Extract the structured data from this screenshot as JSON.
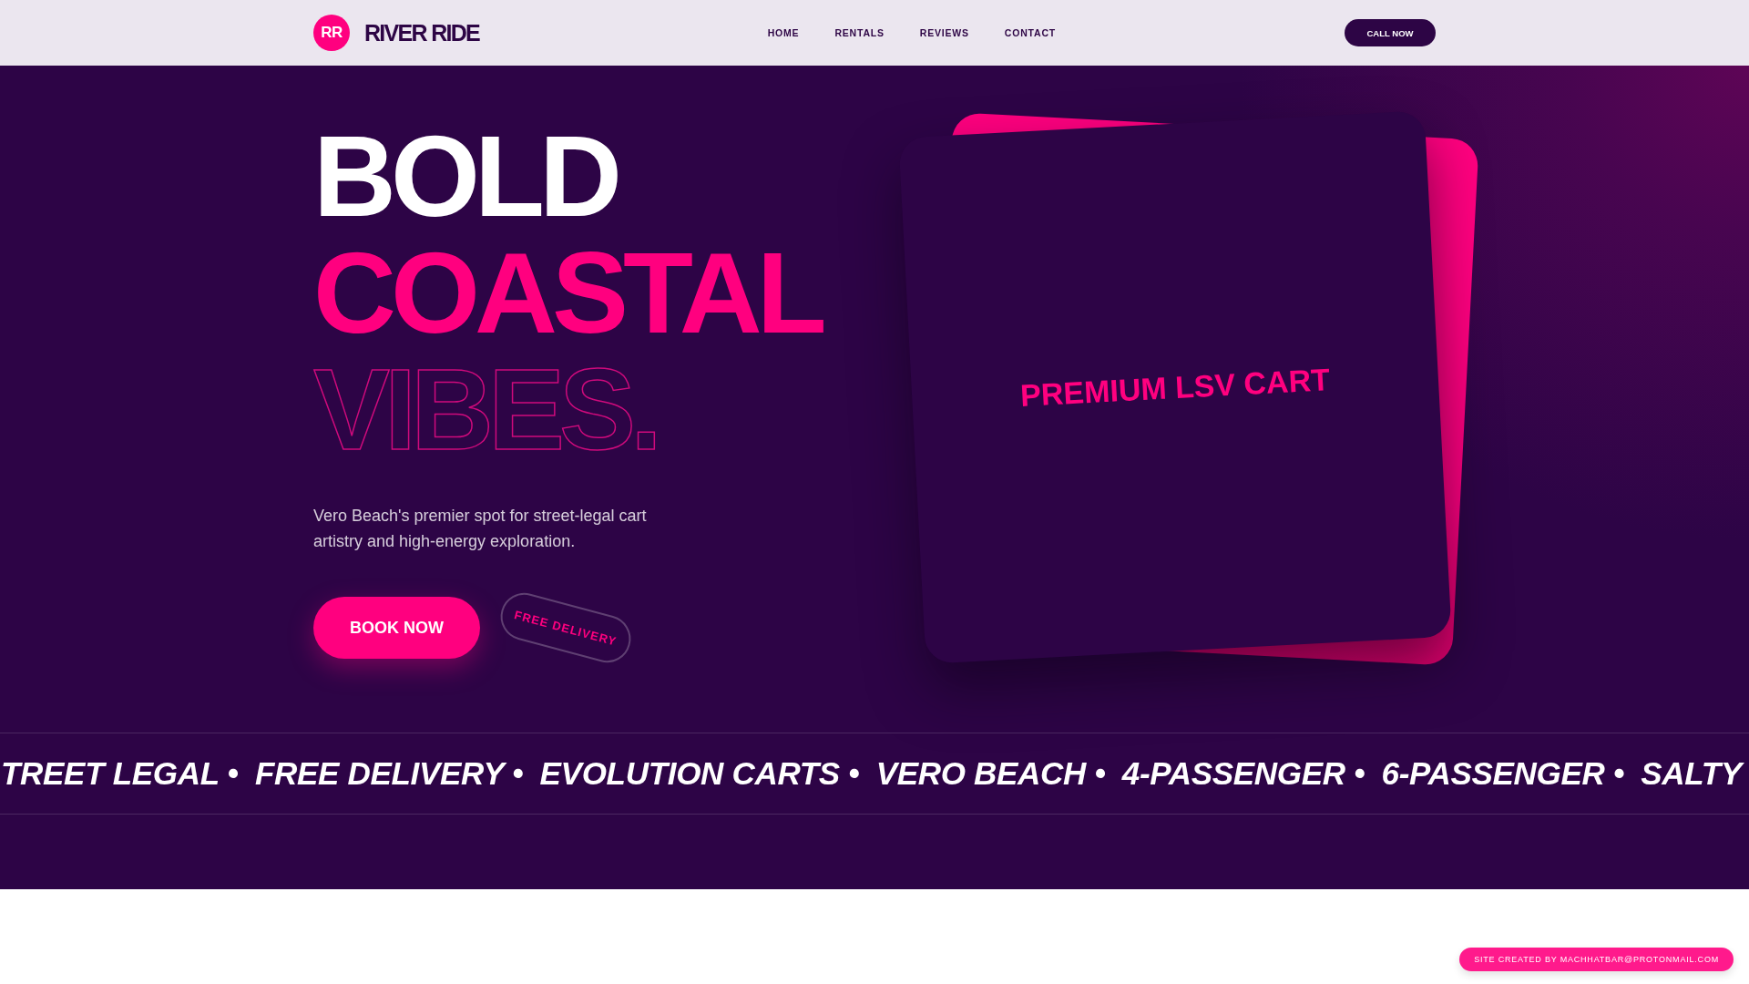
{
  "header": {
    "logo": {
      "initials": "RR",
      "name": "RIVER RIDE"
    },
    "nav": [
      "HOME",
      "RENTALS",
      "REVIEWS",
      "CONTACT"
    ],
    "cta": "CALL NOW"
  },
  "hero": {
    "headline": [
      {
        "text": "BOLD",
        "kind": "solid"
      },
      {
        "text": "COASTAL",
        "kind": "accent"
      },
      {
        "text": "VIBES.",
        "kind": "outline"
      }
    ],
    "tagline": "Vero Beach's premier spot for street-legal cart artistry and high-energy exploration.",
    "primary_button": "BOOK NOW",
    "tag": "FREE DELIVERY",
    "feature_card": {
      "label": "PREMIUM LSV CART"
    }
  },
  "marquee": [
    "TREET LEGAL •",
    "FREE DELIVERY •",
    "EVOLUTION CARTS •",
    "VERO BEACH •",
    "4-PASSENGER •",
    "6-PASSENGER •",
    "SALTY"
  ],
  "footer": {
    "credit": "SITE CREATED BY MACHHATBAR@PROTONMAIL.COM"
  }
}
